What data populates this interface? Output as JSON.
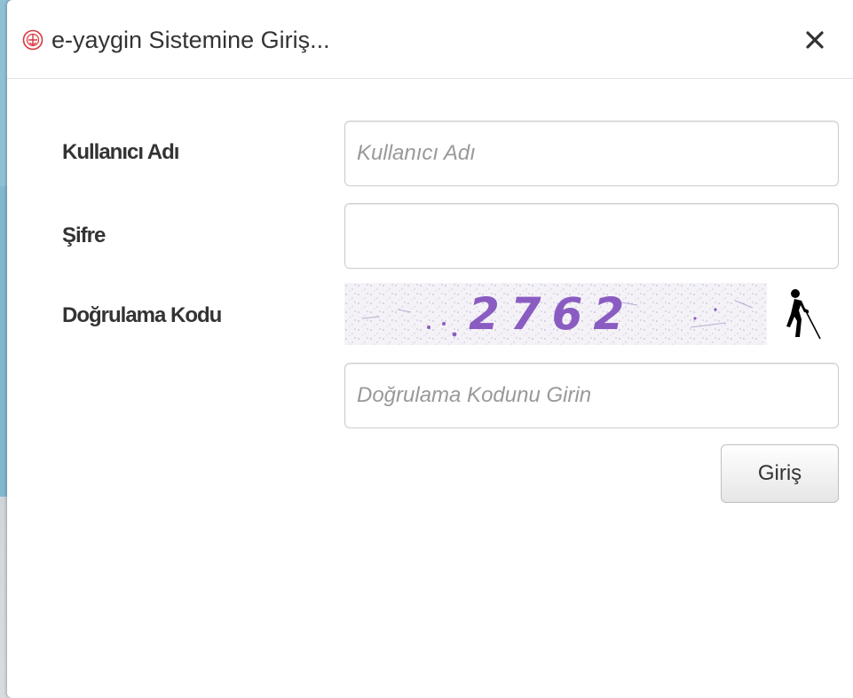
{
  "dialog": {
    "title": "e-yaygin Sistemine Giriş...",
    "close_label": "×"
  },
  "form": {
    "username": {
      "label": "Kullanıcı Adı",
      "placeholder": "Kullanıcı Adı",
      "value": ""
    },
    "password": {
      "label": "Şifre",
      "placeholder": "",
      "value": ""
    },
    "captcha": {
      "label": "Doğrulama Kodu",
      "code": "2762",
      "input_placeholder": "Doğrulama Kodunu Girin",
      "input_value": "",
      "audio_icon": "accessibility-blind-person-icon"
    },
    "submit_label": "Giriş"
  },
  "colors": {
    "captcha_text": "#8a5cc2",
    "captcha_noise": "#b9aed0",
    "logo_red": "#d9363e",
    "backdrop": "#7fb6cf"
  }
}
